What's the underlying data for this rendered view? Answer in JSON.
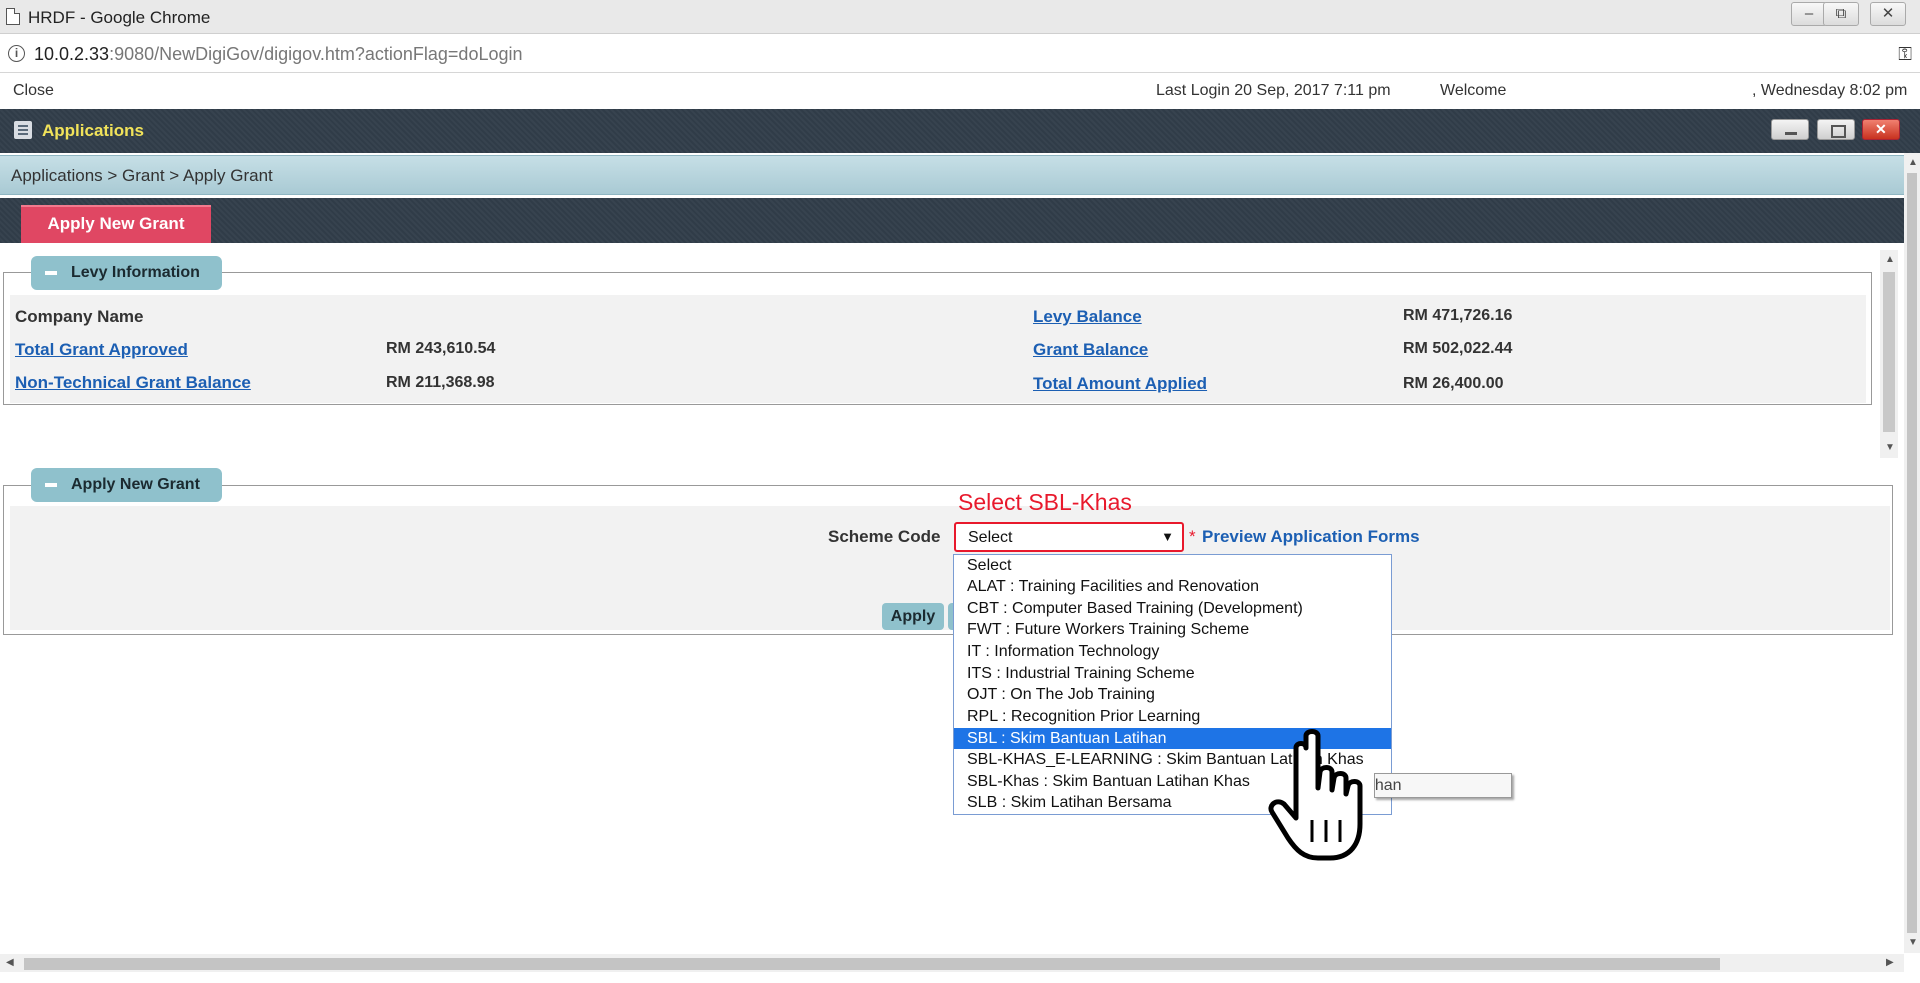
{
  "window": {
    "title": "HRDF - Google Chrome",
    "minimize_symbol": "–",
    "restore_symbol": "⧉",
    "close_symbol": "✕"
  },
  "addressbar": {
    "url_host": "10.0.2.33",
    "url_rest": ":9080/NewDigiGov/digigov.htm?actionFlag=doLogin",
    "key_symbol": "⚿"
  },
  "topstrip": {
    "close_label": "Close",
    "last_login": "Last Login 20 Sep, 2017 7:11 pm",
    "welcome": "Welcome",
    "datetime": ", Wednesday 8:02 pm"
  },
  "appbar": {
    "title": "Applications"
  },
  "breadcrumb": {
    "text": "Applications  > Grant  > Apply Grant"
  },
  "tabs": [
    {
      "label": "Apply New Grant",
      "active": true
    }
  ],
  "levy": {
    "legend": "Levy Information",
    "company_name_label": "Company Name",
    "company_name_value": "",
    "total_grant_approved_label": "Total Grant Approved",
    "total_grant_approved_value": "RM 243,610.54",
    "non_technical_label": "Non-Technical Grant Balance",
    "non_technical_value": "RM 211,368.98",
    "levy_balance_label": "Levy Balance",
    "levy_balance_value": "RM 471,726.16",
    "grant_balance_label": "Grant Balance",
    "grant_balance_value": "RM 502,022.44",
    "total_amount_applied_label": "Total Amount Applied",
    "total_amount_applied_value": "RM 26,400.00"
  },
  "apply": {
    "legend": "Apply New Grant",
    "annotation": "Select SBL-Khas",
    "scheme_label": "Scheme Code",
    "select_value": "Select",
    "required_star": "*",
    "preview_link": "Preview Application Forms",
    "apply_button": "Apply",
    "options": [
      "Select",
      "ALAT : Training Facilities and Renovation",
      "CBT : Computer Based Training (Development)",
      "FWT : Future Workers Training Scheme",
      "IT : Information Technology",
      "ITS : Industrial Training Scheme",
      "OJT : On The Job Training",
      "RPL : Recognition Prior Learning",
      "SBL : Skim Bantuan Latihan",
      "SBL-KHAS_E-LEARNING : Skim Bantuan Latihan Khas",
      "SBL-Khas : Skim Bantuan Latihan Khas",
      "SLB : Skim Latihan Bersama"
    ],
    "highlighted_option": "SBL : Skim Bantuan Latihan",
    "tooltip": "SBL : Skim Bantuan Latihan"
  },
  "colors": {
    "accent_tab": "#e04763",
    "legend_bg": "#8fc1cc",
    "link": "#1c5fb3",
    "annotation": "#e8192c",
    "highlight": "#1e74e6"
  }
}
